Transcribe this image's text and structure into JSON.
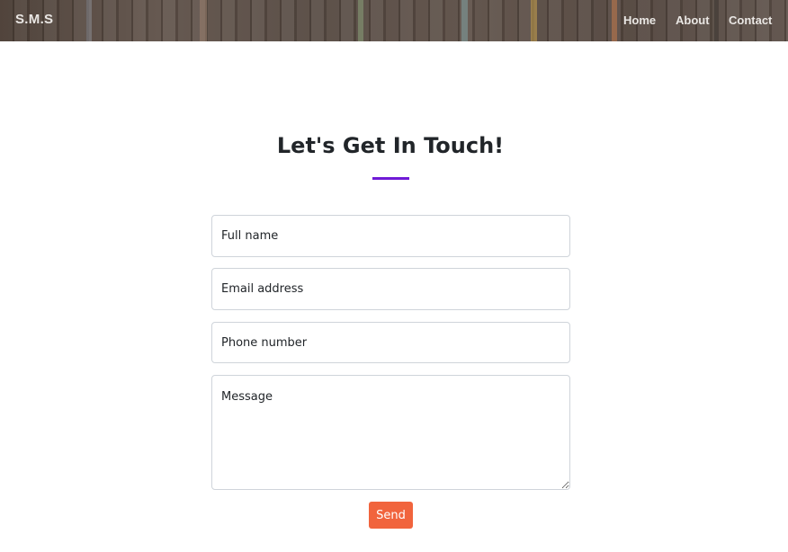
{
  "navbar": {
    "brand": "S.M.S",
    "links": [
      "Home",
      "About",
      "Contact"
    ]
  },
  "contact": {
    "heading": "Let's Get In Touch!",
    "accent_color": "#6f1ad6",
    "fields": {
      "name_placeholder": "Full name",
      "email_placeholder": "Email address",
      "phone_placeholder": "Phone number",
      "message_placeholder": "Message"
    },
    "send_label": "Send",
    "send_color": "#f1643d"
  }
}
